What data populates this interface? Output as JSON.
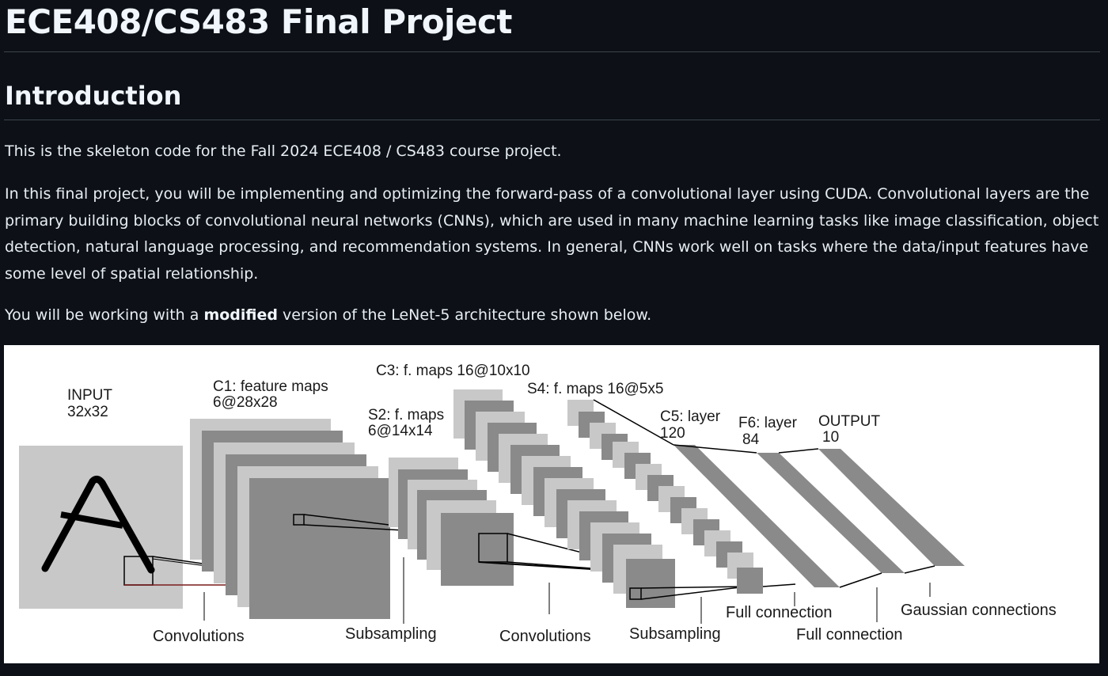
{
  "page": {
    "title": "ECE408/CS483 Final Project",
    "intro_heading": "Introduction",
    "para1": "This is the skeleton code for the Fall 2024 ECE408 / CS483 course project.",
    "para2": "In this final project, you will be implementing and optimizing the forward-pass of a convolutional layer using CUDA. Convolutional layers are the primary building blocks of convolutional neural networks (CNNs), which are used in many machine learning tasks like image classification, object detection, natural language processing, and recommendation systems. In general, CNNs work well on tasks where the data/input features have some level of spatial relationship.",
    "para3_before": "You will be working with a ",
    "para3_bold": "modified",
    "para3_after": " version of the LeNet-5 architecture shown below."
  },
  "diagram": {
    "input_label_line1": "INPUT",
    "input_label_line2": "32x32",
    "c1_line1": "C1: feature maps",
    "c1_line2": "6@28x28",
    "s2_line1": "S2: f. maps",
    "s2_line2": "6@14x14",
    "c3_label": "C3: f. maps 16@10x10",
    "s4_label": "S4: f. maps 16@5x5",
    "c5_line1": "C5: layer",
    "c5_line2": "120",
    "f6_line1": "F6: layer",
    "f6_line2": "84",
    "out_line1": "OUTPUT",
    "out_line2": "10",
    "op_convolutions_1": "Convolutions",
    "op_subsampling_1": "Subsampling",
    "op_convolutions_2": "Convolutions",
    "op_subsampling_2": "Subsampling",
    "op_full_connection_1": "Full connection",
    "op_full_connection_2": "Full connection",
    "op_gaussian": "Gaussian connections",
    "colors": {
      "light_map": "#c8c8c8",
      "dark_map": "#8a8a8a",
      "stroke": "#000000"
    }
  }
}
